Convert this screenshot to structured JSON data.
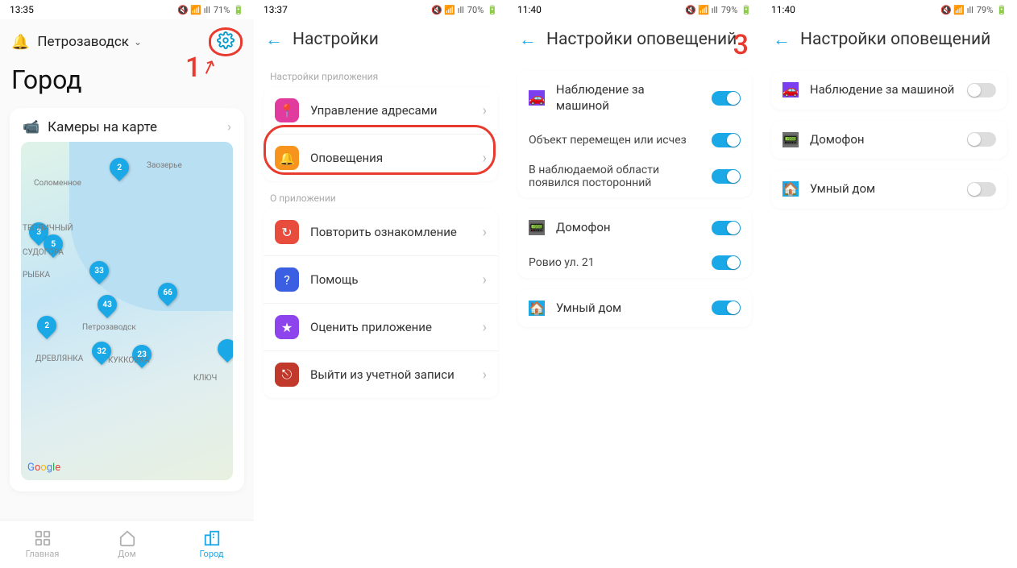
{
  "screen1": {
    "status": {
      "time": "13:35",
      "right": "71%"
    },
    "city": "Петрозаводск",
    "title": "Город",
    "cameras": "Камеры на карте",
    "map": {
      "pins": [
        {
          "t": 20,
          "l": 110,
          "n": "2"
        },
        {
          "t": 100,
          "l": 10,
          "n": "3"
        },
        {
          "t": 115,
          "l": 28,
          "n": "5"
        },
        {
          "t": 148,
          "l": 85,
          "n": "33"
        },
        {
          "t": 190,
          "l": 95,
          "n": "43"
        },
        {
          "t": 175,
          "l": 170,
          "n": "66"
        },
        {
          "t": 216,
          "l": 20,
          "n": "2"
        },
        {
          "t": 248,
          "l": 88,
          "n": "32"
        },
        {
          "t": 252,
          "l": 138,
          "n": "23"
        },
        {
          "t": 245,
          "l": 244,
          "n": ""
        }
      ],
      "labels": [
        {
          "t": 24,
          "l": 156,
          "s": "Заозерье"
        },
        {
          "t": 46,
          "l": 16,
          "s": "Соломенное"
        },
        {
          "t": 102,
          "l": 2,
          "s": "ТЕПЛИЧНЫЙ"
        },
        {
          "t": 132,
          "l": 2,
          "s": "СУДОГОРА"
        },
        {
          "t": 160,
          "l": 2,
          "s": "РЫБКА"
        },
        {
          "t": 225,
          "l": 76,
          "s": "Петрозаводск"
        },
        {
          "t": 264,
          "l": 18,
          "s": "ДРЕВЛЯНКА"
        },
        {
          "t": 266,
          "l": 108,
          "s": "КУККОВКА"
        },
        {
          "t": 288,
          "l": 214,
          "s": "КЛЮЧ"
        }
      ]
    },
    "nav": {
      "home": "Главная",
      "house": "Дом",
      "city": "Город"
    }
  },
  "screen2": {
    "status": {
      "time": "13:37",
      "right": "70%"
    },
    "title": "Настройки",
    "section1": "Настройки приложения",
    "addr": "Управление адресами",
    "notif": "Оповещения",
    "section2": "О приложении",
    "onboard": "Повторить ознакомление",
    "help": "Помощь",
    "rate": "Оценить приложение",
    "logout": "Выйти из учетной записи"
  },
  "screen3": {
    "status": {
      "time": "11:40",
      "right": "79%"
    },
    "title": "Настройки оповещений",
    "car": "Наблюдение за машиной",
    "car_s1": "Объект перемещен или исчез",
    "car_s2": "В наблюдаемой области появился посторонний",
    "intercom": "Домофон",
    "intercom_s1": "Ровио ул. 21",
    "smart": "Умный дом"
  },
  "screen4": {
    "status": {
      "time": "11:40",
      "right": "79%"
    },
    "title": "Настройки оповещений",
    "car": "Наблюдение за машиной",
    "intercom": "Домофон",
    "smart": "Умный дом"
  },
  "annotations": {
    "one": "1",
    "three": "3"
  },
  "colors": {
    "accent": "#1aa8e6",
    "highlight_ring": "#e83a2f",
    "ic_magenta": "#e23b9e",
    "ic_orange": "#f7941e",
    "ic_red": "#e74c3c",
    "ic_blue": "#3b5fe2",
    "ic_purple": "#8e44ec",
    "ic_darkred": "#c0392b",
    "ic_violet": "#7b3ff2",
    "ic_gray": "#6d6d6d",
    "ic_cyan": "#1aa8e6"
  }
}
